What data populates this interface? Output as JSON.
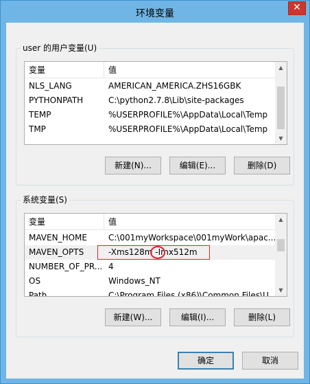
{
  "window": {
    "title": "环境变量",
    "close_glyph": "✕"
  },
  "user_group": {
    "label": "user 的用户变量(U)",
    "columns": [
      "变量",
      "值"
    ],
    "rows": [
      {
        "name": "NLS_LANG",
        "value": "AMERICAN_AMERICA.ZHS16GBK"
      },
      {
        "name": "PYTHONPATH",
        "value": "C:\\python2.7.8\\Lib\\site-packages"
      },
      {
        "name": "TEMP",
        "value": "%USERPROFILE%\\AppData\\Local\\Temp"
      },
      {
        "name": "TMP",
        "value": "%USERPROFILE%\\AppData\\Local\\Temp"
      }
    ],
    "buttons": {
      "new": "新建(N)...",
      "edit": "编辑(E)...",
      "delete": "删除(D)"
    }
  },
  "system_group": {
    "label": "系统变量(S)",
    "columns": [
      "变量",
      "值"
    ],
    "rows": [
      {
        "name": "MAVEN_HOME",
        "value": "C:\\001myWorkspace\\001myWork\\apac..."
      },
      {
        "name": "MAVEN_OPTS",
        "value": "-Xms128m -Imx512m"
      },
      {
        "name": "NUMBER_OF_PR...",
        "value": "4"
      },
      {
        "name": "OS",
        "value": "Windows_NT"
      },
      {
        "name": "Path",
        "value": "C:\\Program Files (x86)\\Common Files\\U..."
      }
    ],
    "buttons": {
      "new": "新建(W)...",
      "edit": "编辑(I)...",
      "delete": "删除(L)"
    }
  },
  "footer": {
    "ok": "确定",
    "cancel": "取消"
  },
  "icons": {
    "scroll_up": "scroll-up-arrow-icon",
    "scroll_down": "scroll-down-arrow-icon",
    "close": "close-icon"
  },
  "colors": {
    "title_bar": "#6fb6e6",
    "close_button": "#c7392c",
    "annotation": "#e0222f"
  }
}
